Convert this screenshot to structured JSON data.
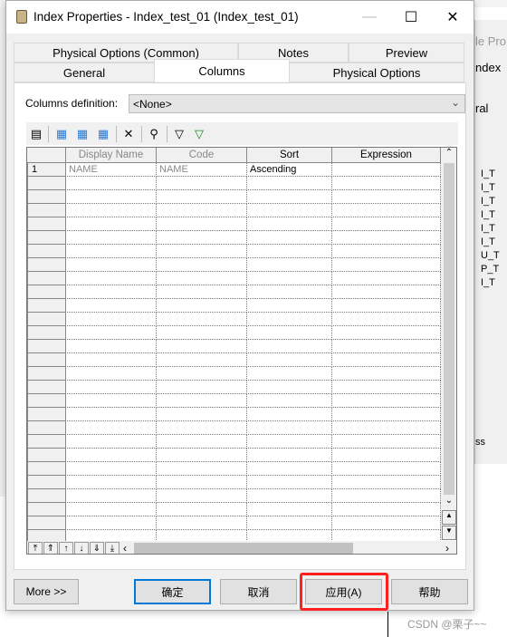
{
  "window": {
    "title": "Index Properties - Index_test_01 (Index_test_01)"
  },
  "tabs_row1": [
    {
      "label": "Physical Options (Common)"
    },
    {
      "label": "Notes"
    },
    {
      "label": "Preview"
    }
  ],
  "tabs_row2": [
    {
      "label": "General"
    },
    {
      "label": "Columns",
      "active": true
    },
    {
      "label": "Physical Options"
    }
  ],
  "columns_definition": {
    "label": "Columns definition:",
    "value": "<None>"
  },
  "toolbar": [
    "properties-icon",
    "add-column-icon",
    "insert-column-icon",
    "add-row-icon",
    "delete-icon",
    "find-icon",
    "filter-edit-icon",
    "filter-apply-icon"
  ],
  "grid": {
    "headers": [
      "Display Name",
      "Code",
      "Sort",
      "Expression"
    ],
    "rows": [
      {
        "num": "1",
        "display_name": "NAME",
        "code": "NAME",
        "sort": "Ascending",
        "expression": ""
      }
    ]
  },
  "buttons": {
    "more": "More >>",
    "ok": "确定",
    "cancel": "取消",
    "apply": "应用(A)",
    "help": "帮助"
  },
  "highlight_color": "#ff2020",
  "background_window": {
    "title": "le Pro",
    "tab1": "ndex",
    "tab2": "ral",
    "rows": [
      "I_T",
      "I_T",
      "I_T",
      "I_T",
      "I_T",
      "I_T",
      "U_T",
      "P_T",
      "I_T"
    ],
    "button": "ss"
  },
  "watermark": "CSDN @栗子~~"
}
